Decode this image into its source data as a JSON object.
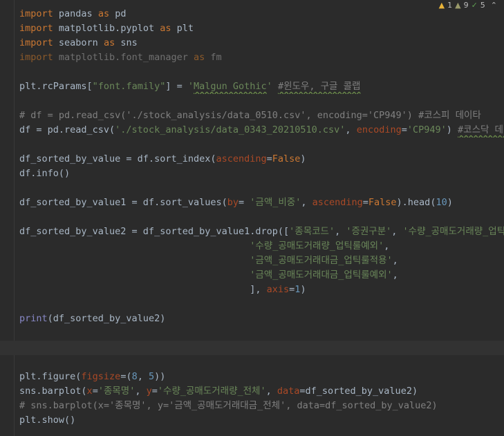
{
  "inspections": {
    "errors_icon": "warning-triangle-icon",
    "errors_count": "1",
    "warnings_icon": "weak-warning-triangle-icon",
    "warnings_count": "9",
    "typos_icon": "double-check-icon",
    "typos_count": "5",
    "chevron_icon": "chevron-up-icon"
  },
  "code": {
    "l1_import": "import",
    "l1_mod": " pandas ",
    "l1_as": "as",
    "l1_alias": " pd",
    "l2_import": "import",
    "l2_mod": " matplotlib.pyplot ",
    "l2_as": "as",
    "l2_alias": " plt",
    "l3_import": "import",
    "l3_mod": " seaborn ",
    "l3_as": "as",
    "l3_alias": " sns",
    "l4_import": "import",
    "l4_mod": " matplotlib.font_manager ",
    "l4_as": "as",
    "l4_alias": " fm",
    "l6_a": "plt.rcParams[",
    "l6_str1": "\"font.family\"",
    "l6_b": "] = ",
    "l6_q1": "'",
    "l6_font": "Malgun Gothic",
    "l6_q2": "'",
    "l6_sp": " ",
    "l6_cmt": "#윈도우, 구글 콜랩",
    "l8_cmt": "# df = pd.read_csv('./stock_analysis/data_0510.csv', encoding='CP949') #코스피 데이타",
    "l9_a": "df = pd.read_csv(",
    "l9_str": "'./stock_analysis/data_0343_20210510.csv'",
    "l9_b": ", ",
    "l9_prm": "encoding",
    "l9_c": "=",
    "l9_str2": "'CP949'",
    "l9_d": ") ",
    "l9_cmt": "#코스닥 데이타",
    "l11_a": "df_sorted_by_value = df.sort_index(",
    "l11_prm": "ascending",
    "l11_b": "=",
    "l11_kw": "False",
    "l11_c": ")",
    "l12_a": "df.info()",
    "l14_a": "df_sorted_by_value1 = df.sort_values(",
    "l14_prm": "by",
    "l14_b": "= ",
    "l14_str": "'금액_비중'",
    "l14_c": ", ",
    "l14_prm2": "ascending",
    "l14_d": "=",
    "l14_kw": "False",
    "l14_e": ").head(",
    "l14_num": "10",
    "l14_f": ")",
    "l16_a": "df_sorted_by_value2 = df_sorted_by_value1.drop([",
    "l16_str1": "'종목코드'",
    "l16_b": ", ",
    "l16_str2": "'증권구분'",
    "l16_c": ", ",
    "l16_str3": "'수량_공매도거래량_업틱룰적용'",
    "l17_pad": "                                         ",
    "l17_str": "'수량_공매도거래량_업틱룰예외'",
    "l17_b": ",",
    "l18_pad": "                                         ",
    "l18_str": "'금액_공매도거래대금_업틱룰적용'",
    "l18_b": ",",
    "l19_pad": "                                         ",
    "l19_str": "'금액_공매도거래대금_업틱룰예외'",
    "l19_b": ",",
    "l20_pad": "                                         ",
    "l20_a": "], ",
    "l20_prm": "axis",
    "l20_b": "=",
    "l20_num": "1",
    "l20_c": ")",
    "l22_bi": "print",
    "l22_a": "(df_sorted_by_value2)",
    "l25_a": "plt.figure(",
    "l25_prm": "figsize",
    "l25_b": "=(",
    "l25_num1": "8",
    "l25_c": ", ",
    "l25_num2": "5",
    "l25_d": "))",
    "l26_a": "sns.barplot(",
    "l26_prm1": "x",
    "l26_b": "=",
    "l26_str1": "'종목명'",
    "l26_c": ", ",
    "l26_prm2": "y",
    "l26_d": "=",
    "l26_str2": "'수량_공매도거래량_전체'",
    "l26_e": ", ",
    "l26_prm3": "data",
    "l26_f": "=df_sorted_by_value2)",
    "l27_cmt": "# sns.barplot(x='종목명', y='금액_공매도거래대금_전체', data=df_sorted_by_value2)",
    "l28_a": "plt.show()"
  }
}
